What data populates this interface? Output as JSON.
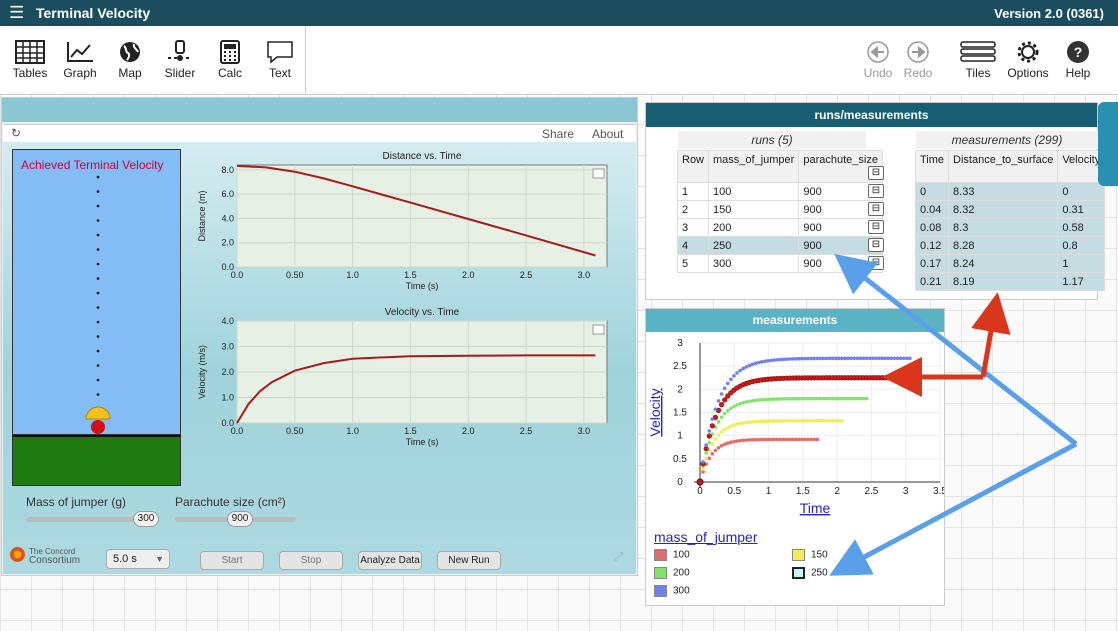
{
  "app": {
    "title": "Terminal Velocity",
    "version": "Version 2.0 (0361)"
  },
  "toolbar": {
    "left": [
      {
        "label": "Tables",
        "icon": "tables-icon"
      },
      {
        "label": "Graph",
        "icon": "graph-icon"
      },
      {
        "label": "Map",
        "icon": "map-icon"
      },
      {
        "label": "Slider",
        "icon": "slider-icon"
      },
      {
        "label": "Calc",
        "icon": "calc-icon"
      },
      {
        "label": "Text",
        "icon": "text-icon"
      }
    ],
    "right": [
      {
        "label": "Undo",
        "icon": "undo-icon"
      },
      {
        "label": "Redo",
        "icon": "redo-icon"
      },
      {
        "label": "Tiles",
        "icon": "tiles-icon"
      },
      {
        "label": "Options",
        "icon": "gear-icon"
      },
      {
        "label": "Help",
        "icon": "help-icon"
      }
    ]
  },
  "sim": {
    "share": "Share",
    "about": "About",
    "achieved": "Achieved Terminal Velocity",
    "mass_label": "Mass of jumper (g)",
    "mass_value": "300",
    "chute_label": "Parachute size (cm²)",
    "chute_value": "900",
    "duration": "5.0 s",
    "logo_line1": "The Concord",
    "logo_line2": "Consortium",
    "buttons": {
      "start": "Start",
      "stop": "Stop",
      "analyze": "Analyze Data",
      "new_run": "New Run"
    }
  },
  "chart_data": [
    {
      "type": "line",
      "title": "Distance vs. Time",
      "xlabel": "Time (s)",
      "ylabel": "Distance (m)",
      "xlim": [
        0,
        3.2
      ],
      "ylim": [
        0,
        8.4
      ],
      "xticks": [
        "0.0",
        "0.50",
        "1.0",
        "1.5",
        "2.0",
        "2.5",
        "3.0"
      ],
      "yticks": [
        "0.0",
        "2.0",
        "4.0",
        "6.0",
        "8.0"
      ],
      "x": [
        0,
        0.25,
        0.5,
        0.75,
        1.0,
        1.5,
        2.0,
        2.5,
        3.1
      ],
      "y": [
        8.33,
        8.2,
        7.85,
        7.3,
        6.65,
        5.3,
        3.95,
        2.6,
        0.95
      ]
    },
    {
      "type": "line",
      "title": "Velocity vs. Time",
      "xlabel": "Time (s)",
      "ylabel": "Velocity (m/s)",
      "xlim": [
        0,
        3.2
      ],
      "ylim": [
        0,
        4.0
      ],
      "xticks": [
        "0.0",
        "0.50",
        "1.0",
        "1.5",
        "2.0",
        "2.5",
        "3.0"
      ],
      "yticks": [
        "0.0",
        "1.0",
        "2.0",
        "3.0",
        "4.0"
      ],
      "x": [
        0,
        0.1,
        0.2,
        0.3,
        0.5,
        0.75,
        1.0,
        1.5,
        2.0,
        2.5,
        3.1
      ],
      "y": [
        0,
        0.75,
        1.25,
        1.6,
        2.05,
        2.35,
        2.52,
        2.62,
        2.64,
        2.65,
        2.65
      ]
    },
    {
      "type": "scatter",
      "title": "measurements",
      "xlabel": "Time",
      "ylabel": "Velocity",
      "xlim": [
        0,
        3.5
      ],
      "ylim": [
        0,
        3
      ],
      "xticks": [
        "0",
        "0.5",
        "1",
        "1.5",
        "2",
        "2.5",
        "3",
        "3.5"
      ],
      "yticks": [
        "0",
        "0.5",
        "1",
        "1.5",
        "2",
        "2.5",
        "3"
      ],
      "legend_title": "mass_of_jumper",
      "series": [
        {
          "name": "100",
          "color": "#e36b6b",
          "terminal": 0.92,
          "tend": 1.75
        },
        {
          "name": "150",
          "color": "#f2ec58",
          "terminal": 1.32,
          "tend": 2.1
        },
        {
          "name": "200",
          "color": "#7fe566",
          "terminal": 1.8,
          "tend": 2.45
        },
        {
          "name": "250",
          "color": "#c91c1c",
          "terminal": 2.25,
          "tend": 2.75
        },
        {
          "name": "300",
          "color": "#7081ef",
          "terminal": 2.67,
          "tend": 3.1
        }
      ]
    }
  ],
  "tables": {
    "title": "runs/measurements",
    "runs_title": "runs (5)",
    "runs_headers": [
      "Row",
      "mass_of_jumper",
      "parachute_size"
    ],
    "runs_rows": [
      [
        "1",
        "100",
        "900"
      ],
      [
        "2",
        "150",
        "900"
      ],
      [
        "3",
        "200",
        "900"
      ],
      [
        "4",
        "250",
        "900"
      ],
      [
        "5",
        "300",
        "900"
      ]
    ],
    "meas_title": "measurements (299)",
    "meas_headers": [
      "Time",
      "Distance_to_surface",
      "Velocity"
    ],
    "meas_rows": [
      [
        "0",
        "8.33",
        "0"
      ],
      [
        "0.04",
        "8.32",
        "0.31"
      ],
      [
        "0.08",
        "8.3",
        "0.58"
      ],
      [
        "0.12",
        "8.28",
        "0.8"
      ],
      [
        "0.17",
        "8.24",
        "1"
      ],
      [
        "0.21",
        "8.19",
        "1.17"
      ]
    ]
  }
}
